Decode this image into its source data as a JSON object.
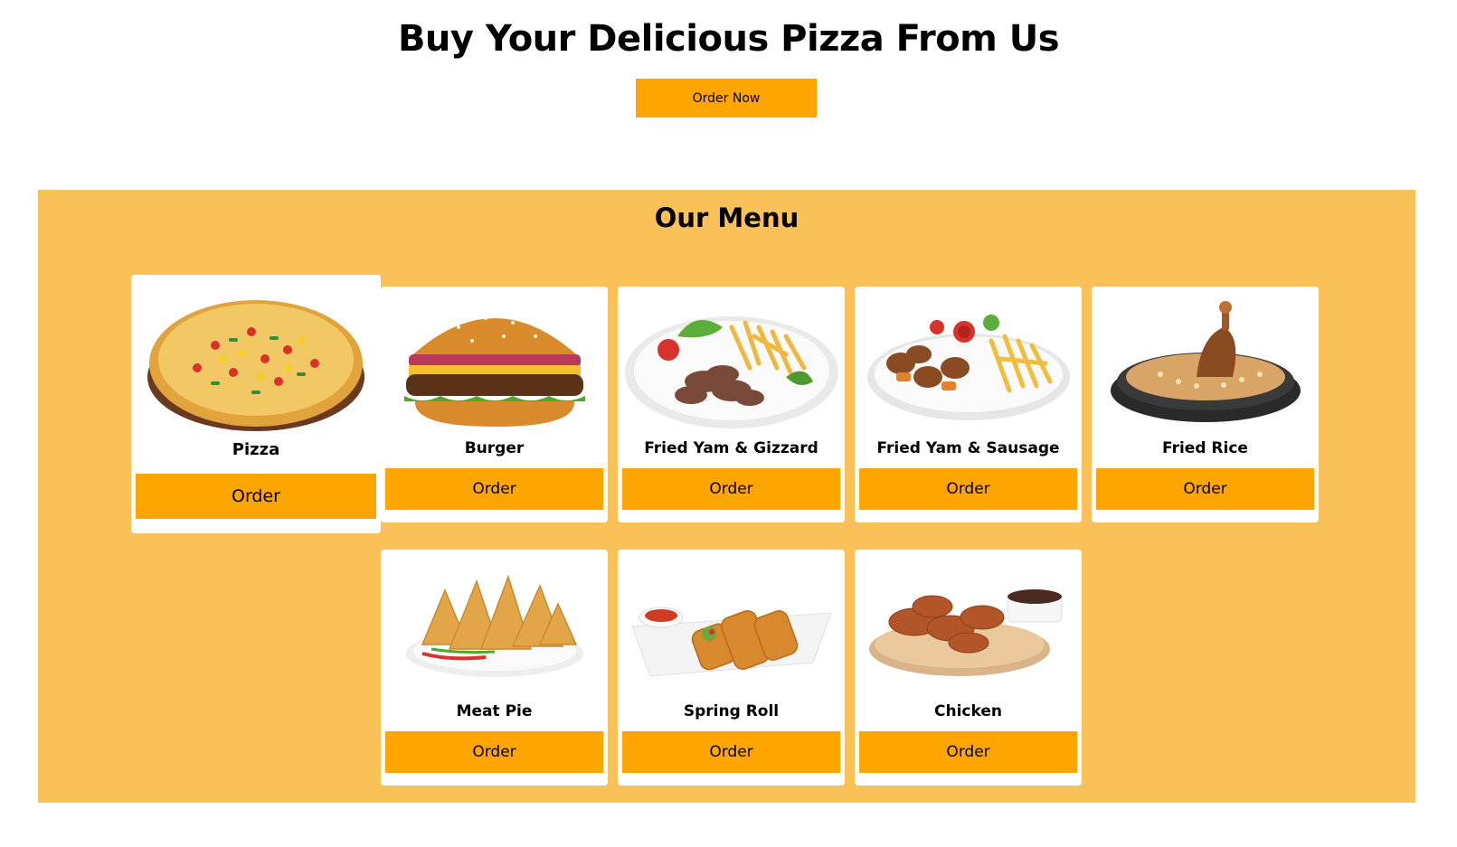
{
  "hero": {
    "title": "Buy Your Delicious Pizza From Us",
    "order_now_label": "Order Now"
  },
  "menu": {
    "title": "Our Menu",
    "items": [
      {
        "name": "Pizza",
        "button": "Order",
        "icon": "pizza-image"
      },
      {
        "name": "Burger",
        "button": "Order",
        "icon": "burger-image"
      },
      {
        "name": "Fried Yam & Gizzard",
        "button": "Order",
        "icon": "fried-yam-gizzard-image"
      },
      {
        "name": "Fried Yam & Sausage",
        "button": "Order",
        "icon": "fried-yam-sausage-image"
      },
      {
        "name": "Fried Rice",
        "button": "Order",
        "icon": "fried-rice-image"
      },
      {
        "name": "Meat Pie",
        "button": "Order",
        "icon": "meat-pie-image"
      },
      {
        "name": "Spring Roll",
        "button": "Order",
        "icon": "spring-roll-image"
      },
      {
        "name": "Chicken",
        "button": "Order",
        "icon": "chicken-image"
      }
    ]
  },
  "colors": {
    "accent": "#ffa500",
    "section_bg": "#f9c157",
    "card_bg": "#ffffff"
  }
}
